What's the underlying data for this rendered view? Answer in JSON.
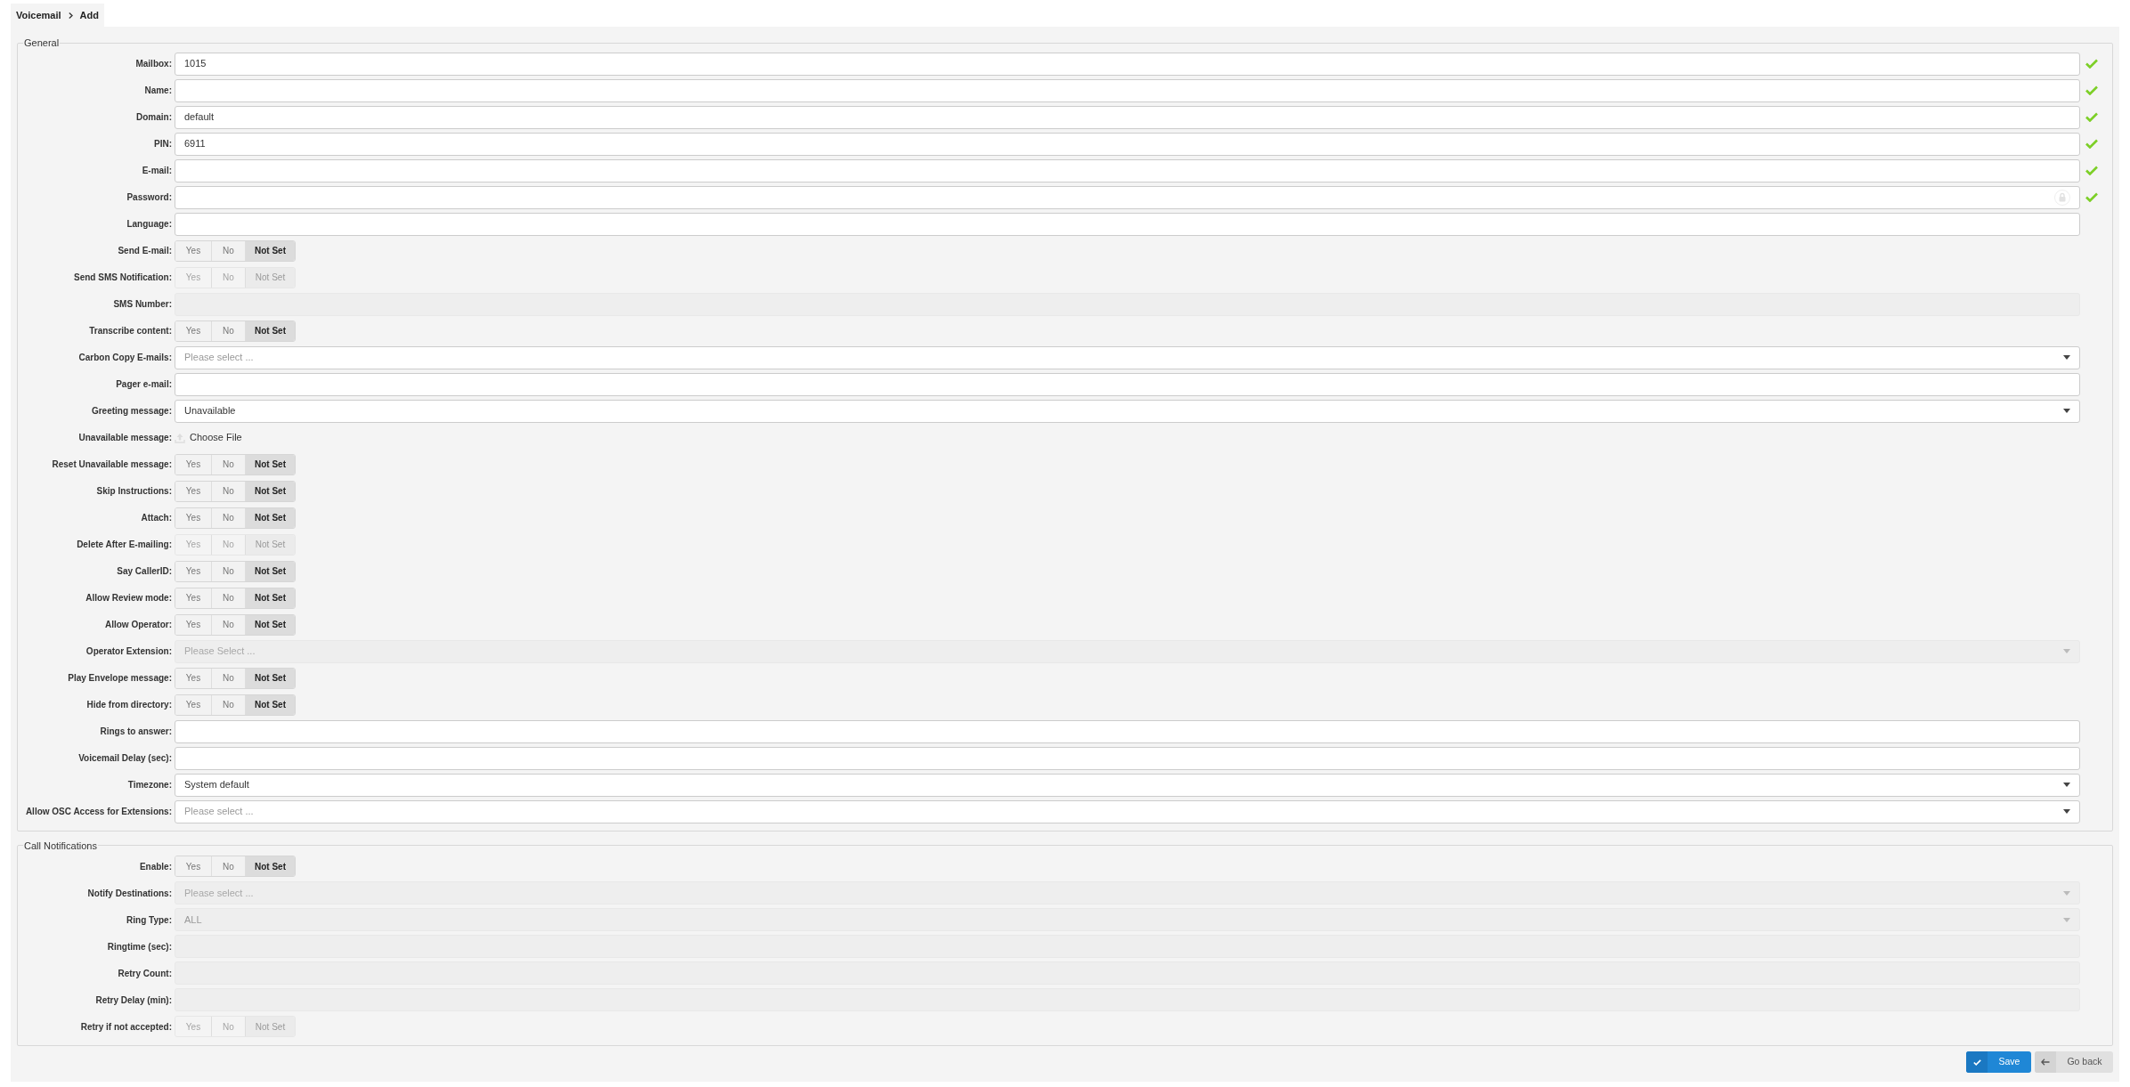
{
  "breadcrumb": [
    "Voicemail",
    "Add"
  ],
  "sections": [
    {
      "legend": "General",
      "rows": [
        {
          "label": "Mailbox:",
          "kind": "text",
          "value": "1015",
          "valid": true,
          "disabled": false
        },
        {
          "label": "Name:",
          "kind": "text",
          "valid": true,
          "disabled": false
        },
        {
          "label": "Domain:",
          "kind": "text",
          "value": "default",
          "valid": true,
          "disabled": false
        },
        {
          "label": "PIN:",
          "kind": "text",
          "value": "6911",
          "valid": true,
          "disabled": false
        },
        {
          "label": "E-mail:",
          "kind": "text",
          "valid": true,
          "disabled": false
        },
        {
          "label": "Password:",
          "kind": "password",
          "valid": true,
          "disabled": false
        },
        {
          "label": "Language:",
          "kind": "text",
          "disabled": false
        },
        {
          "label": "Send E-mail:",
          "kind": "toggle",
          "disabled": false,
          "options": [
            {
              "label": "Yes",
              "selected": false
            },
            {
              "label": "No",
              "selected": false
            },
            {
              "label": "Not Set",
              "selected": true
            }
          ]
        },
        {
          "label": "Send SMS Notification:",
          "kind": "toggle",
          "disabled": true,
          "options": [
            {
              "label": "Yes",
              "selected": false
            },
            {
              "label": "No",
              "selected": false
            },
            {
              "label": "Not Set",
              "selected": true
            }
          ]
        },
        {
          "label": "SMS Number:",
          "kind": "text",
          "disabled": true
        },
        {
          "label": "Transcribe content:",
          "kind": "toggle",
          "disabled": false,
          "options": [
            {
              "label": "Yes",
              "selected": false
            },
            {
              "label": "No",
              "selected": false
            },
            {
              "label": "Not Set",
              "selected": true
            }
          ]
        },
        {
          "label": "Carbon Copy E-mails:",
          "kind": "select",
          "placeholder": "Please select ...",
          "disabled": false
        },
        {
          "label": "Pager e-mail:",
          "kind": "text",
          "disabled": false
        },
        {
          "label": "Greeting message:",
          "kind": "select",
          "value": "Unavailable",
          "disabled": false
        },
        {
          "label": "Unavailable message:",
          "kind": "file",
          "value": "Choose File"
        },
        {
          "label": "Reset Unavailable message:",
          "kind": "toggle",
          "disabled": false,
          "options": [
            {
              "label": "Yes",
              "selected": false
            },
            {
              "label": "No",
              "selected": false
            },
            {
              "label": "Not Set",
              "selected": true
            }
          ]
        },
        {
          "label": "Skip Instructions:",
          "kind": "toggle",
          "disabled": false,
          "options": [
            {
              "label": "Yes",
              "selected": false
            },
            {
              "label": "No",
              "selected": false
            },
            {
              "label": "Not Set",
              "selected": true
            }
          ]
        },
        {
          "label": "Attach:",
          "kind": "toggle",
          "disabled": false,
          "options": [
            {
              "label": "Yes",
              "selected": false
            },
            {
              "label": "No",
              "selected": false
            },
            {
              "label": "Not Set",
              "selected": true
            }
          ]
        },
        {
          "label": "Delete After E-mailing:",
          "kind": "toggle",
          "disabled": true,
          "options": [
            {
              "label": "Yes",
              "selected": false
            },
            {
              "label": "No",
              "selected": false
            },
            {
              "label": "Not Set",
              "selected": true
            }
          ]
        },
        {
          "label": "Say CallerID:",
          "kind": "toggle",
          "disabled": false,
          "options": [
            {
              "label": "Yes",
              "selected": false
            },
            {
              "label": "No",
              "selected": false
            },
            {
              "label": "Not Set",
              "selected": true
            }
          ]
        },
        {
          "label": "Allow Review mode:",
          "kind": "toggle",
          "disabled": false,
          "options": [
            {
              "label": "Yes",
              "selected": false
            },
            {
              "label": "No",
              "selected": false
            },
            {
              "label": "Not Set",
              "selected": true
            }
          ]
        },
        {
          "label": "Allow Operator:",
          "kind": "toggle",
          "disabled": false,
          "options": [
            {
              "label": "Yes",
              "selected": false
            },
            {
              "label": "No",
              "selected": false
            },
            {
              "label": "Not Set",
              "selected": true
            }
          ]
        },
        {
          "label": "Operator Extension:",
          "kind": "select",
          "placeholder": "Please Select ...",
          "disabled": true
        },
        {
          "label": "Play Envelope message:",
          "kind": "toggle",
          "disabled": false,
          "options": [
            {
              "label": "Yes",
              "selected": false
            },
            {
              "label": "No",
              "selected": false
            },
            {
              "label": "Not Set",
              "selected": true
            }
          ]
        },
        {
          "label": "Hide from directory:",
          "kind": "toggle",
          "disabled": false,
          "options": [
            {
              "label": "Yes",
              "selected": false
            },
            {
              "label": "No",
              "selected": false
            },
            {
              "label": "Not Set",
              "selected": true
            }
          ]
        },
        {
          "label": "Rings to answer:",
          "kind": "text",
          "disabled": false
        },
        {
          "label": "Voicemail Delay (sec):",
          "kind": "text",
          "disabled": false
        },
        {
          "label": "Timezone:",
          "kind": "select",
          "value": "System default",
          "disabled": false
        },
        {
          "label": "Allow OSC Access for Extensions:",
          "kind": "select",
          "placeholder": "Please select ...",
          "disabled": false
        }
      ]
    },
    {
      "legend": "Call Notifications",
      "rows": [
        {
          "label": "Enable:",
          "kind": "toggle",
          "disabled": false,
          "options": [
            {
              "label": "Yes",
              "selected": false
            },
            {
              "label": "No",
              "selected": false
            },
            {
              "label": "Not Set",
              "selected": true
            }
          ]
        },
        {
          "label": "Notify Destinations:",
          "kind": "select",
          "placeholder": "Please select ...",
          "disabled": true
        },
        {
          "label": "Ring Type:",
          "kind": "select",
          "value": "ALL",
          "disabled": true
        },
        {
          "label": "Ringtime (sec):",
          "kind": "text",
          "disabled": true
        },
        {
          "label": "Retry Count:",
          "kind": "text",
          "disabled": true
        },
        {
          "label": "Retry Delay (min):",
          "kind": "text",
          "disabled": true
        },
        {
          "label": "Retry if not accepted:",
          "kind": "toggle",
          "disabled": true,
          "options": [
            {
              "label": "Yes",
              "selected": false
            },
            {
              "label": "No",
              "selected": false
            },
            {
              "label": "Not Set",
              "selected": true
            }
          ]
        }
      ]
    }
  ],
  "buttons": [
    {
      "label": "Save",
      "kind": "primary"
    },
    {
      "label": "Go back",
      "kind": "secondary"
    }
  ]
}
